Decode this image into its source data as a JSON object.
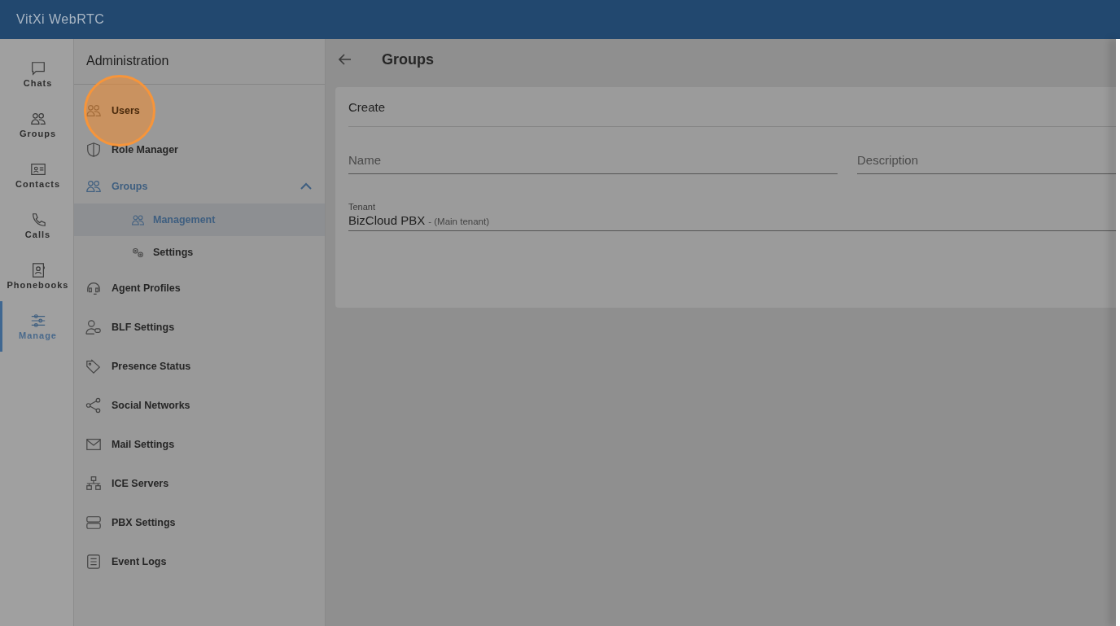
{
  "app_bar": {
    "title": "VitXi WebRTC"
  },
  "rail": [
    {
      "label": "Chats",
      "selected": false
    },
    {
      "label": "Groups",
      "selected": false
    },
    {
      "label": "Contacts",
      "selected": false
    },
    {
      "label": "Calls",
      "selected": false
    },
    {
      "label": "Phonebooks",
      "selected": false
    },
    {
      "label": "Manage",
      "selected": true
    }
  ],
  "admin_menu": {
    "title": "Administration",
    "items": [
      {
        "label": "Users",
        "selected": false,
        "highlighted": true
      },
      {
        "label": "Role Manager",
        "selected": false
      },
      {
        "label": "Groups",
        "selected": false,
        "expanded": true,
        "children": [
          {
            "label": "Management",
            "selected": true
          },
          {
            "label": "Settings",
            "selected": false
          }
        ]
      },
      {
        "label": "Agent Profiles",
        "selected": false
      },
      {
        "label": "BLF Settings",
        "selected": false
      },
      {
        "label": "Presence Status",
        "selected": false
      },
      {
        "label": "Social Networks",
        "selected": false
      },
      {
        "label": "Mail Settings",
        "selected": false
      },
      {
        "label": "ICE Servers",
        "selected": false
      },
      {
        "label": "PBX Settings",
        "selected": false
      },
      {
        "label": "Event Logs",
        "selected": false
      }
    ]
  },
  "page": {
    "title": "Groups",
    "card": {
      "title": "Create",
      "fields": [
        {
          "placeholder": "Name"
        },
        {
          "placeholder": "Description"
        }
      ],
      "tenant": {
        "label": "Tenant",
        "value": "BizCloud PBX",
        "note": "- (Main tenant)"
      }
    }
  }
}
